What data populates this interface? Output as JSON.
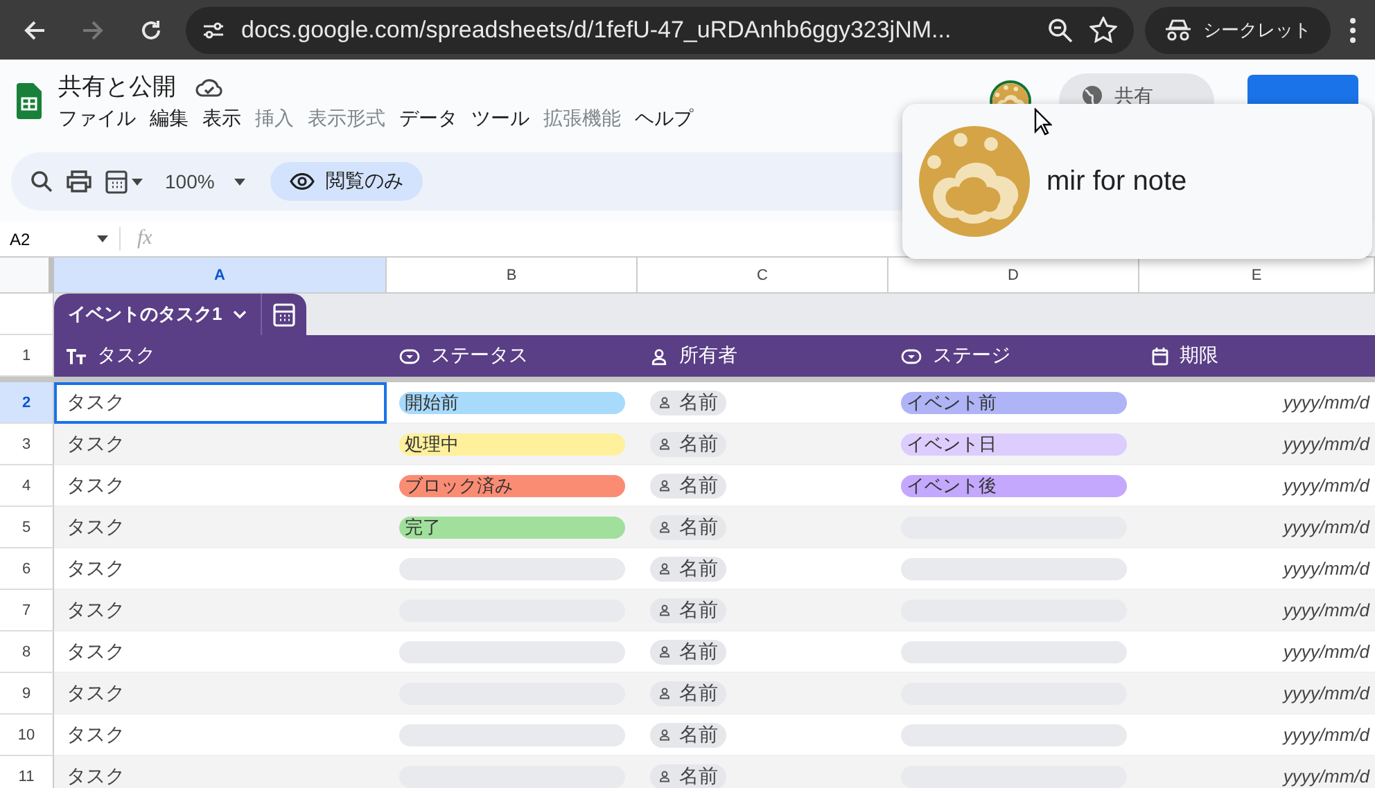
{
  "browser": {
    "url": "docs.google.com/spreadsheets/d/1fefU-47_uRDAnhb6ggy323jNM...",
    "incognito_label": "シークレット"
  },
  "doc": {
    "title": "共有と公開",
    "menus": [
      {
        "label": "ファイル",
        "disabled": false
      },
      {
        "label": "編集",
        "disabled": false
      },
      {
        "label": "表示",
        "disabled": false
      },
      {
        "label": "挿入",
        "disabled": true
      },
      {
        "label": "表示形式",
        "disabled": true
      },
      {
        "label": "データ",
        "disabled": false
      },
      {
        "label": "ツール",
        "disabled": false
      },
      {
        "label": "拡張機能",
        "disabled": true
      },
      {
        "label": "ヘルプ",
        "disabled": false
      }
    ]
  },
  "share": {
    "label": "共有"
  },
  "toolbar": {
    "zoom": "100%",
    "view_only": "閲覧のみ"
  },
  "formula_bar": {
    "cell_ref": "A2",
    "fx": "fx"
  },
  "columns": [
    {
      "label": "A",
      "selected": true
    },
    {
      "label": "B",
      "selected": false
    },
    {
      "label": "C",
      "selected": false
    },
    {
      "label": "D",
      "selected": false
    },
    {
      "label": "E",
      "selected": false
    }
  ],
  "table": {
    "name": "イベントのタスク1",
    "header_row": "1",
    "headers": [
      {
        "label": "タスク",
        "kind": "text"
      },
      {
        "label": "ステータス",
        "kind": "dropdown"
      },
      {
        "label": "所有者",
        "kind": "person"
      },
      {
        "label": "ステージ",
        "kind": "dropdown"
      },
      {
        "label": "期限",
        "kind": "date"
      }
    ],
    "rows": [
      {
        "num": "2",
        "selected": true,
        "task": "タスク",
        "status": {
          "label": "開始前",
          "color": "#a8dafc"
        },
        "owner": "名前",
        "stage": {
          "label": "イベント前",
          "color": "#aeb4f5"
        },
        "due": "yyyy/mm/d"
      },
      {
        "num": "3",
        "selected": false,
        "task": "タスク",
        "status": {
          "label": "処理中",
          "color": "#fff09b"
        },
        "owner": "名前",
        "stage": {
          "label": "イベント日",
          "color": "#dccdfe"
        },
        "due": "yyyy/mm/d"
      },
      {
        "num": "4",
        "selected": false,
        "task": "タスク",
        "status": {
          "label": "ブロック済み",
          "color": "#fb8c74"
        },
        "owner": "名前",
        "stage": {
          "label": "イベント後",
          "color": "#c4a8fd"
        },
        "due": "yyyy/mm/d"
      },
      {
        "num": "5",
        "selected": false,
        "task": "タスク",
        "status": {
          "label": "完了",
          "color": "#a0e09c"
        },
        "owner": "名前",
        "stage": null,
        "due": "yyyy/mm/d"
      },
      {
        "num": "6",
        "selected": false,
        "task": "タスク",
        "status": null,
        "owner": "名前",
        "stage": null,
        "due": "yyyy/mm/d"
      },
      {
        "num": "7",
        "selected": false,
        "task": "タスク",
        "status": null,
        "owner": "名前",
        "stage": null,
        "due": "yyyy/mm/d"
      },
      {
        "num": "8",
        "selected": false,
        "task": "タスク",
        "status": null,
        "owner": "名前",
        "stage": null,
        "due": "yyyy/mm/d"
      },
      {
        "num": "9",
        "selected": false,
        "task": "タスク",
        "status": null,
        "owner": "名前",
        "stage": null,
        "due": "yyyy/mm/d"
      },
      {
        "num": "10",
        "selected": false,
        "task": "タスク",
        "status": null,
        "owner": "名前",
        "stage": null,
        "due": "yyyy/mm/d"
      },
      {
        "num": "11",
        "selected": false,
        "task": "タスク",
        "status": null,
        "owner": "名前",
        "stage": null,
        "due": "yyyy/mm/d"
      }
    ]
  },
  "popup": {
    "name": "mir for note"
  }
}
